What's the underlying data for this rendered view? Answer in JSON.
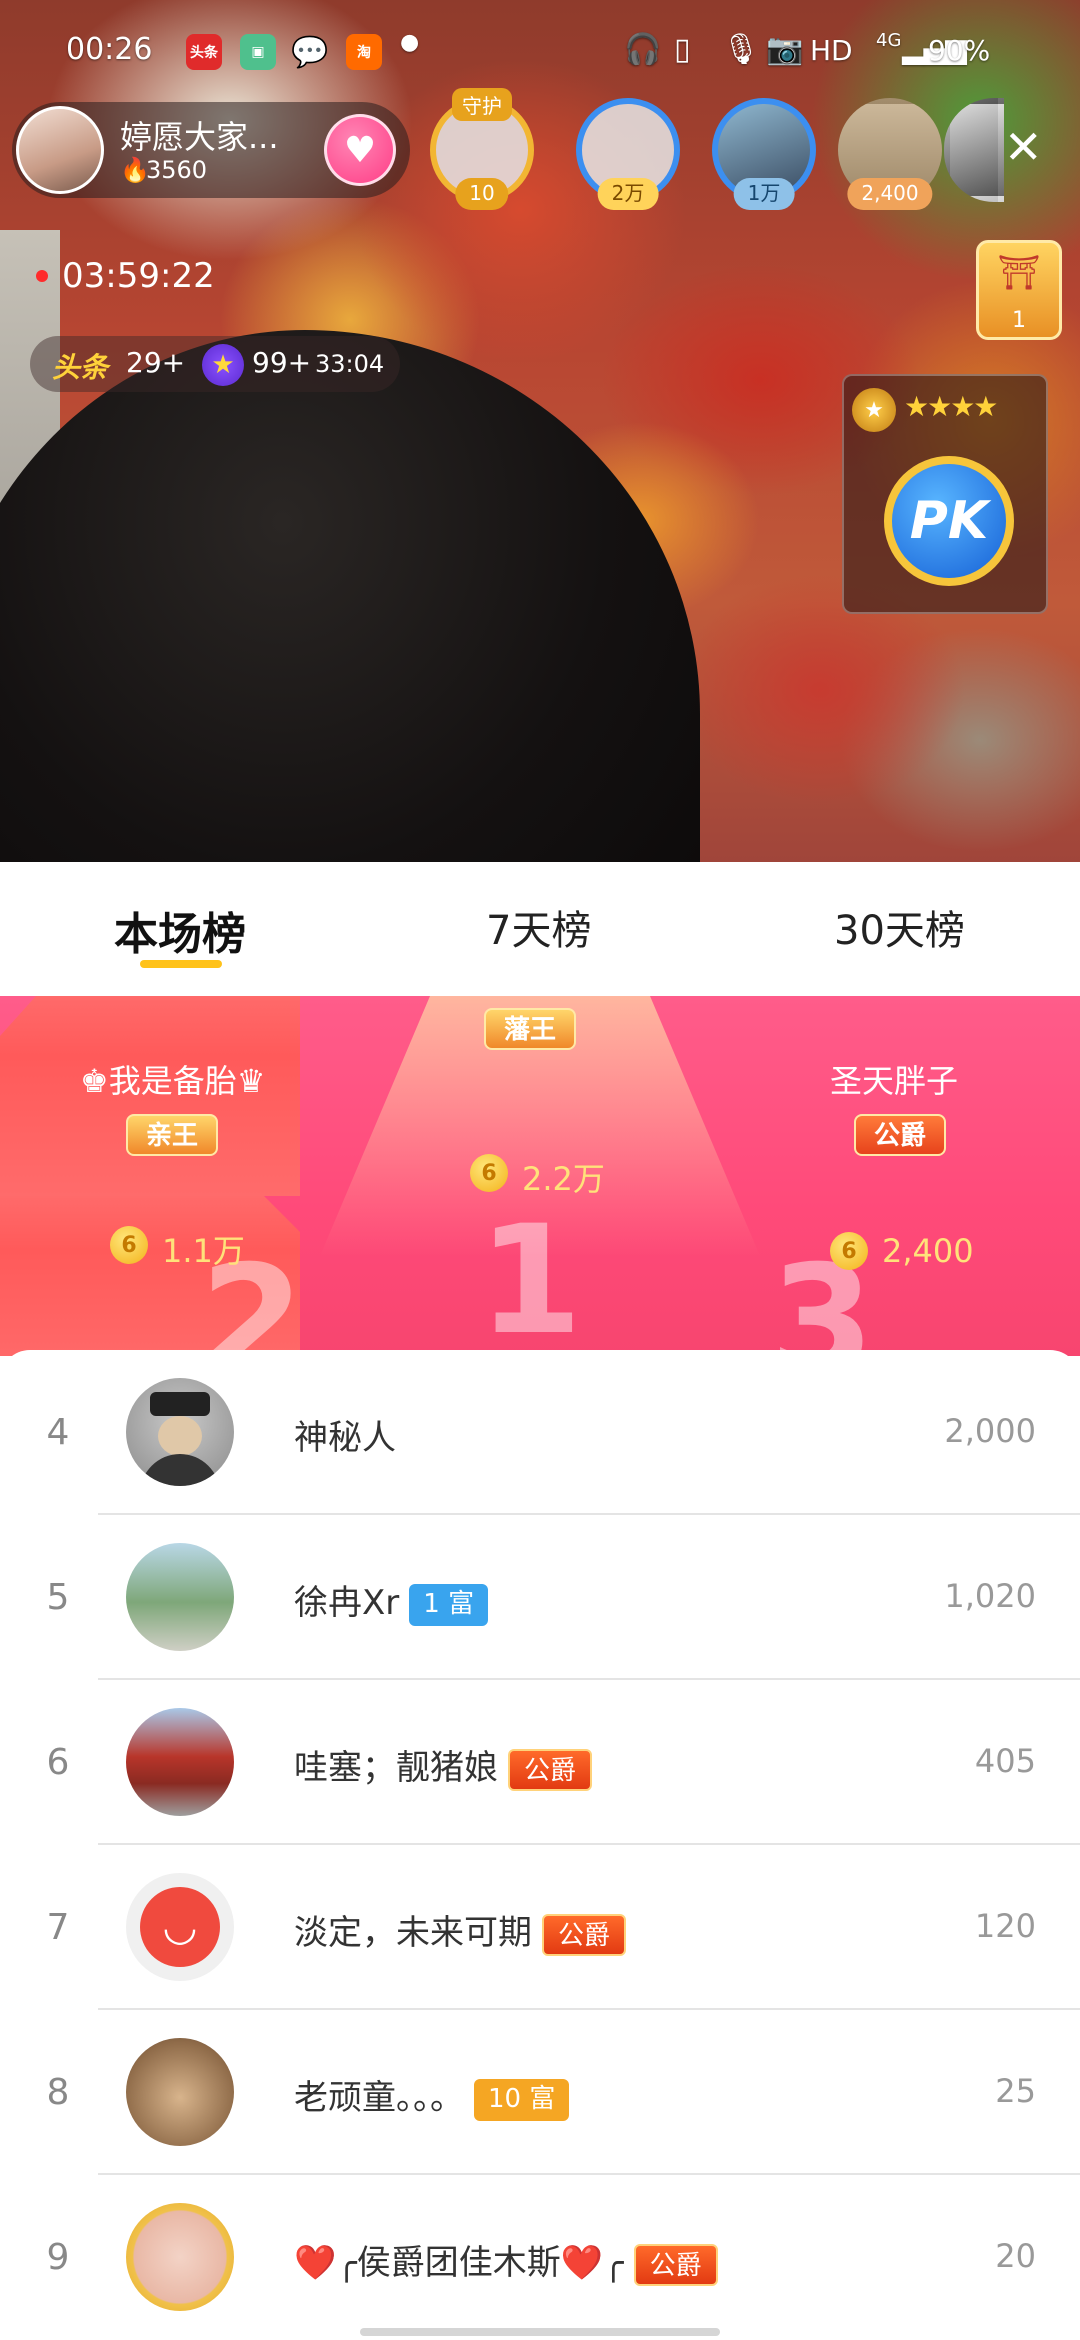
{
  "status_bar": {
    "time": "00:26",
    "app_icons": [
      "头条",
      "",
      "",
      "淘"
    ],
    "hd": "HD",
    "network": "4G",
    "battery": "90%"
  },
  "host": {
    "name": "婷愿大家...",
    "heat": "3560"
  },
  "guards": {
    "guard_badge": "守护",
    "guard_count": "10",
    "viewers": [
      {
        "tag": "2万"
      },
      {
        "tag": "1万"
      },
      {
        "tag": "2,400"
      }
    ]
  },
  "live_timer": "03:59:22",
  "stats": {
    "toutiao_label": "头条",
    "toutiao_count": "29+",
    "star_count": "99+",
    "star_time": "33:04"
  },
  "palace_badge_num": "1",
  "pk": {
    "stars": "★★★★",
    "label": "PK"
  },
  "tabs": [
    {
      "label": "本场榜",
      "active": true
    },
    {
      "label": "7天榜",
      "active": false
    },
    {
      "label": "30天榜",
      "active": false
    }
  ],
  "podium": {
    "first": {
      "title": "藩王",
      "value": "2.2万",
      "rank": "1"
    },
    "second": {
      "name": "♚我是备胎♛",
      "title": "亲王",
      "value": "1.1万",
      "rank": "2"
    },
    "third": {
      "name": "圣天胖子",
      "title": "公爵",
      "value": "2,400",
      "rank": "3"
    }
  },
  "coin_symbol": "6",
  "ranking": [
    {
      "rank": "4",
      "name": "神秘人",
      "badge": "",
      "score": "2,000"
    },
    {
      "rank": "5",
      "name": "徐冉Xr",
      "badge": "1 富",
      "score": "1,020"
    },
    {
      "rank": "6",
      "name": "哇塞；靓猪娘",
      "badge": "公爵",
      "score": "405"
    },
    {
      "rank": "7",
      "name": "淡定，未来可期",
      "badge": "公爵",
      "score": "120"
    },
    {
      "rank": "8",
      "name": "老顽童。。。",
      "badge": "10 富",
      "score": "25"
    },
    {
      "rank": "9",
      "name": "❤️╭侯爵团佳木斯❤️╭",
      "badge": "公爵",
      "score": "20"
    }
  ],
  "colors": {
    "accent": "#ffc21a",
    "podium_pink": "#ff4a79",
    "badge_blue": "#39a4ee",
    "badge_orange": "#f5a623",
    "badge_duke": "#e23a12"
  }
}
